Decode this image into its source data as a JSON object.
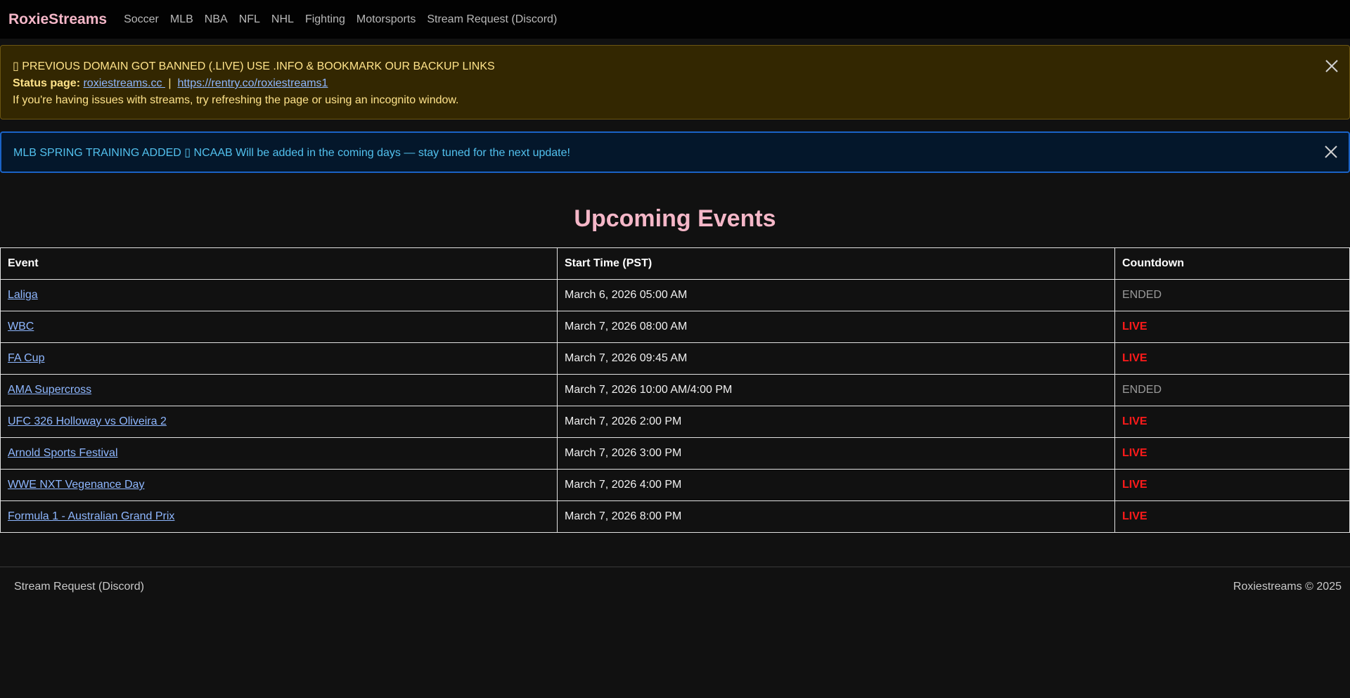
{
  "navbar": {
    "brand": "RoxieStreams",
    "links": [
      "Soccer",
      "MLB",
      "NBA",
      "NFL",
      "NHL",
      "Fighting",
      "Motorsports",
      "Stream Request (Discord)"
    ]
  },
  "alert_warning": {
    "headline": "▯ PREVIOUS DOMAIN GOT BANNED (.LIVE) USE .INFO & BOOKMARK OUR BACKUP LINKS",
    "status_label": "Status page:",
    "link1": "roxiestreams.cc ",
    "separator": "|",
    "link2": "https://rentry.co/roxiestreams1",
    "note": "If you're having issues with streams, try refreshing the page or using an incognito window."
  },
  "alert_info": {
    "text": "MLB SPRING TRAINING ADDED ▯ NCAAB Will be added in the coming days — stay tuned for the next update!"
  },
  "page_title": "Upcoming Events",
  "table": {
    "headers": [
      "Event",
      "Start Time (PST)",
      "Countdown"
    ],
    "rows": [
      {
        "event": "Laliga",
        "time": "March 6, 2026 05:00 AM",
        "status": "ENDED"
      },
      {
        "event": "WBC",
        "time": "March 7, 2026 08:00 AM",
        "status": "LIVE"
      },
      {
        "event": "FA Cup",
        "time": "March 7, 2026 09:45 AM",
        "status": "LIVE"
      },
      {
        "event": "AMA Supercross",
        "time": "March 7, 2026 10:00 AM/4:00 PM",
        "status": "ENDED"
      },
      {
        "event": "UFC 326 Holloway vs Oliveira 2",
        "time": "March 7, 2026 2:00 PM",
        "status": "LIVE"
      },
      {
        "event": "Arnold Sports Festival",
        "time": "March 7, 2026 3:00 PM",
        "status": "LIVE"
      },
      {
        "event": "WWE NXT Vegenance Day",
        "time": "March 7, 2026 4:00 PM",
        "status": "LIVE"
      },
      {
        "event": "Formula 1 - Australian Grand Prix",
        "time": "March 7, 2026 8:00 PM",
        "status": "LIVE"
      }
    ]
  },
  "footer": {
    "left_link": "Stream Request (Discord)",
    "copyright": "Roxiestreams © 2025"
  },
  "colors": {
    "brand": "#f5b7c8",
    "live": "#ff1a1a",
    "ended": "#9a9a9a",
    "link": "#8eb7ff"
  }
}
